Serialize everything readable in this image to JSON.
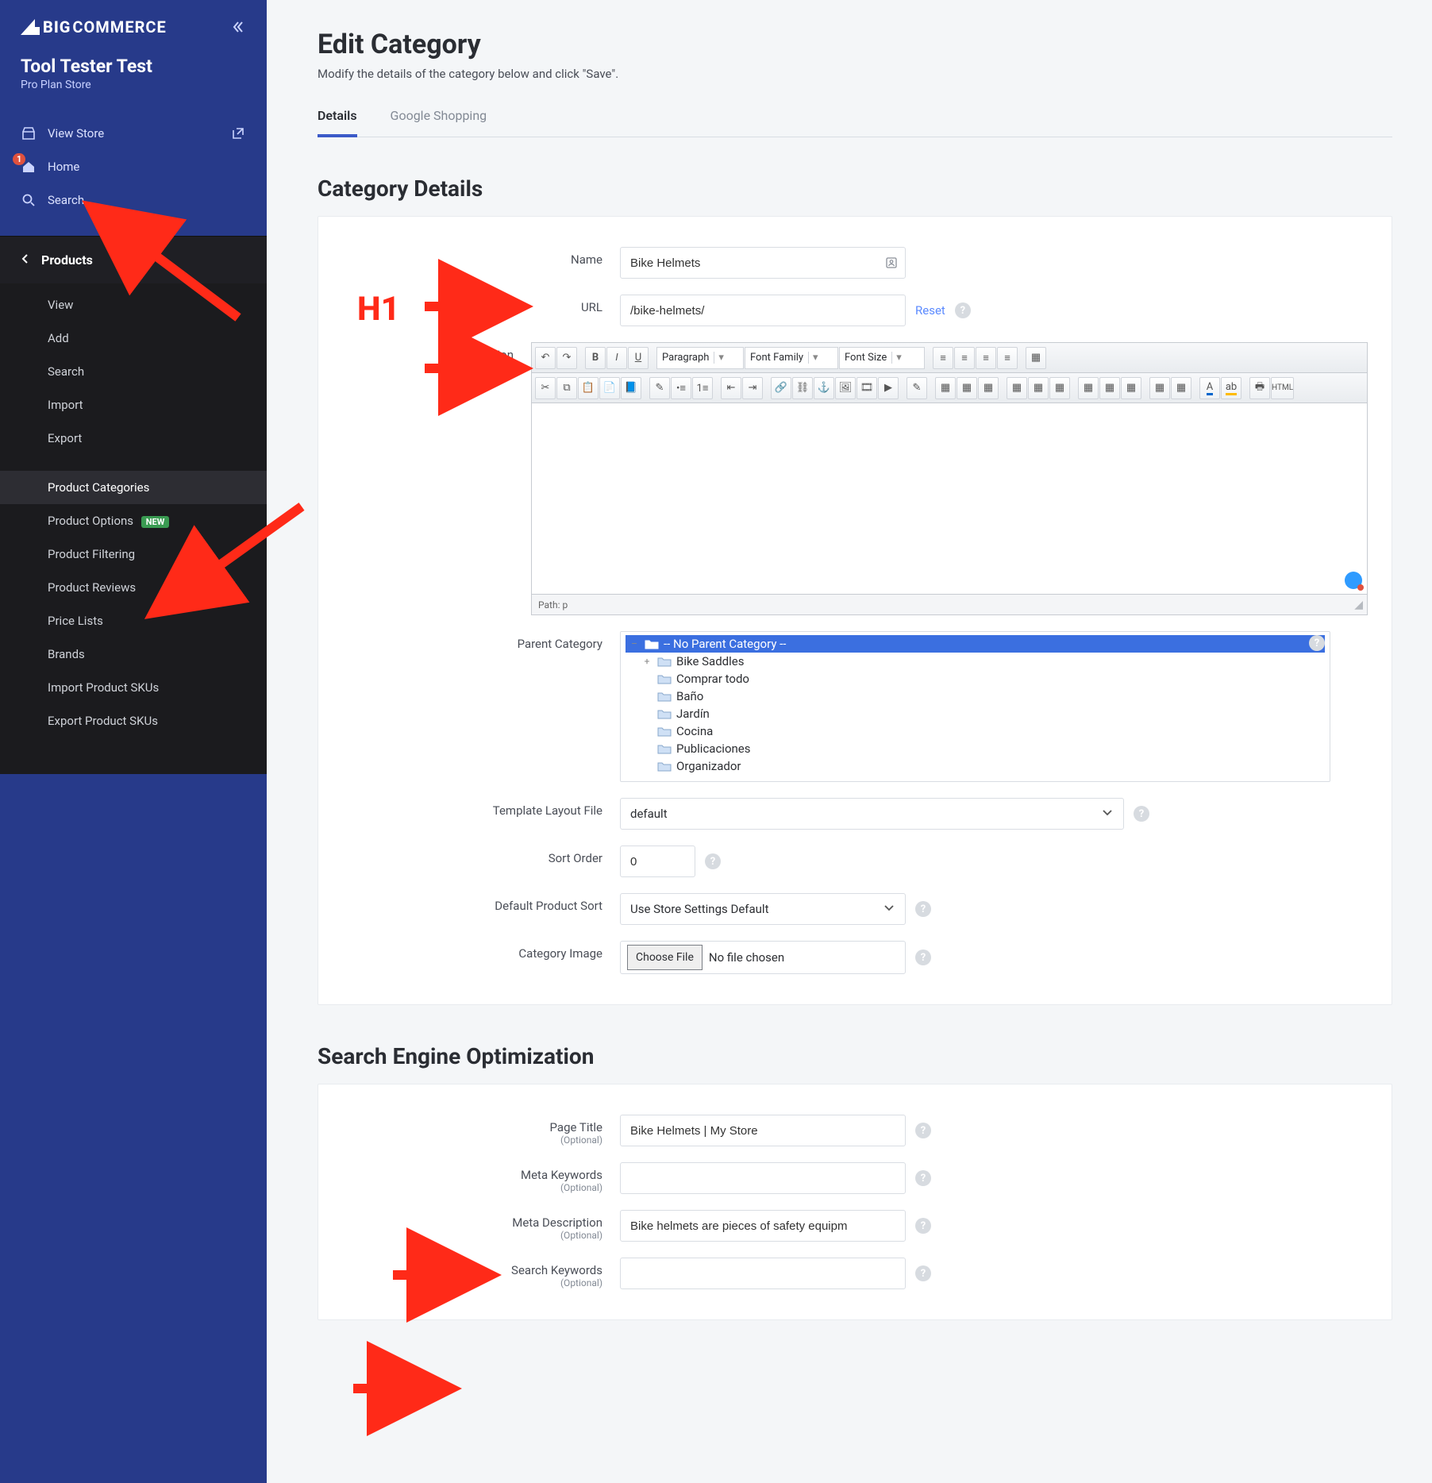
{
  "brand": {
    "big": "BIG",
    "rest": "COMMERCE"
  },
  "store": {
    "name": "Tool Tester Test",
    "plan": "Pro Plan Store"
  },
  "nav": {
    "view_store": "View Store",
    "home": "Home",
    "home_badge": "1",
    "search": "Search",
    "products_head": "Products",
    "items": {
      "view": "View",
      "add": "Add",
      "search": "Search",
      "import": "Import",
      "export": "Export",
      "categories": "Product Categories",
      "options": "Product Options",
      "options_badge": "NEW",
      "filtering": "Product Filtering",
      "reviews": "Product Reviews",
      "pricelists": "Price Lists",
      "brands": "Brands",
      "import_skus": "Import Product SKUs",
      "export_skus": "Export Product SKUs"
    }
  },
  "page": {
    "title": "Edit Category",
    "subtitle": "Modify the details of the category below and click \"Save\"."
  },
  "tabs": {
    "details": "Details",
    "gshop": "Google Shopping"
  },
  "section1": {
    "title": "Category Details",
    "labels": {
      "name": "Name",
      "url": "URL",
      "desc": "Description",
      "parent": "Parent Category",
      "template": "Template Layout File",
      "sort": "Sort Order",
      "default_sort": "Default Product Sort",
      "image": "Category Image"
    },
    "values": {
      "name": "Bike Helmets",
      "url": "/bike-helmets/",
      "reset": "Reset",
      "path": "Path: p",
      "template": "default",
      "sort": "0",
      "default_sort": "Use Store Settings Default",
      "choose_file": "Choose File",
      "no_file": "No file chosen"
    },
    "editor_dd": {
      "para": "Paragraph",
      "family": "Font Family",
      "size": "Font Size"
    },
    "tree": {
      "root": "-- No Parent Category --",
      "items": [
        "Bike Saddles",
        "Comprar todo",
        "Baño",
        "Jardín",
        "Cocina",
        "Publicaciones",
        "Organizador"
      ]
    }
  },
  "section2": {
    "title": "Search Engine Optimization",
    "labels": {
      "page_title": "Page Title",
      "meta_kw": "Meta Keywords",
      "meta_desc": "Meta Description",
      "search_kw": "Search Keywords",
      "optional": "(Optional)"
    },
    "values": {
      "page_title": "Bike Helmets | My Store",
      "meta_kw": "",
      "meta_desc": "Bike helmets are pieces of safety equipm",
      "search_kw": ""
    }
  },
  "annotation": {
    "h1": "H1"
  }
}
